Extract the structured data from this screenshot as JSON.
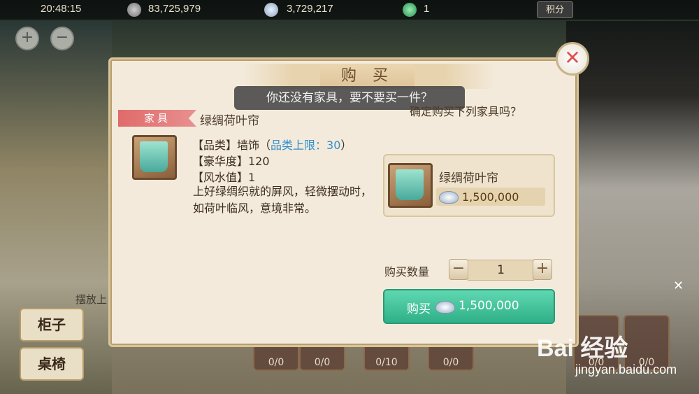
{
  "status_bar": {
    "time": "20:48:15",
    "contribution": "83,725,979",
    "silver": "3,729,217",
    "jade": "1",
    "points_label": "积分"
  },
  "dialog": {
    "title": "购 买",
    "toast": "你还没有家具，要不要买一件？",
    "category_tag": "家具",
    "item_name": "绿绸荷叶帘",
    "stats": {
      "category_prefix": "【品类】墙饰（",
      "category_limit": "品类上限：30",
      "category_suffix": "）",
      "luxury": "【豪华度】120",
      "fengshui": "【风水值】1"
    },
    "description": "上好绿绸织就的屏风，轻微摆动时，如荷叶临风，意境非常。",
    "confirm_text": "确定购买下列家具吗？",
    "card_name": "绿绸荷叶帘",
    "card_price": "1,500,000",
    "quantity_label": "购买数量",
    "quantity_value": "1",
    "buy_label": "购买",
    "buy_price": "1,500,000",
    "close": "✕"
  },
  "left_buttons": {
    "cabinet": "柜子",
    "table_chair": "桌椅",
    "place_hint": "摆放上"
  },
  "slots": [
    "0/0",
    "0/0",
    "0/10",
    "0/0",
    "0/0",
    "0/0"
  ],
  "watermark": {
    "brand": "Bai  经验",
    "url": "jingyan.baidu.com"
  },
  "zoom": {
    "in": "+",
    "out": "−"
  },
  "qty_controls": {
    "minus": "−",
    "plus": "+"
  }
}
